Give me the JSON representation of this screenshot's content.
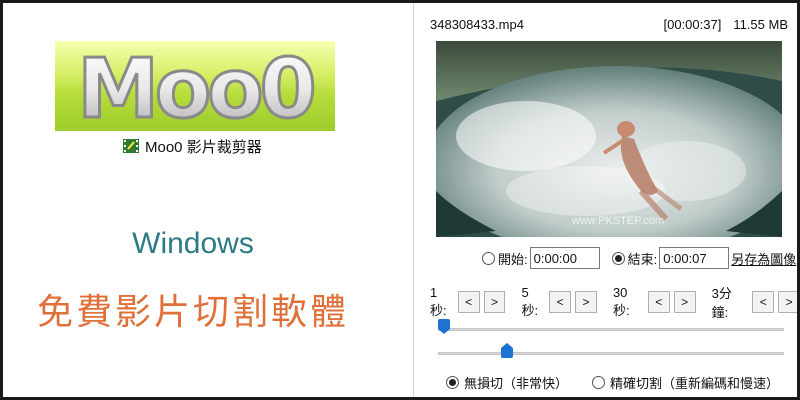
{
  "promo": {
    "logo_text": "Moo0",
    "app_title": "Moo0 影片裁剪器",
    "platform": "Windows",
    "headline": "免費影片切割軟體"
  },
  "app": {
    "file_name": "348308433.mp4",
    "duration": "[00:00:37]",
    "file_size": "11.55 MB",
    "video_watermark": "www.PKSTEP.com",
    "start_label": "開始:",
    "start_value": "0:00:00",
    "end_label": "結束:",
    "end_value": "0:00:07",
    "save_image_link": "另存為圖像",
    "step_controls": [
      {
        "label": "1秒:",
        "back": "<",
        "forward": ">"
      },
      {
        "label": "5秒:",
        "back": "<",
        "forward": ">"
      },
      {
        "label": "30秒:",
        "back": "<",
        "forward": ">"
      },
      {
        "label": "3分鐘:",
        "back": "<",
        "forward": ">"
      }
    ],
    "start_slider_fraction": 0.0,
    "end_slider_fraction": 0.19,
    "cut_modes": [
      {
        "label": "無損切（非常快）",
        "selected": true
      },
      {
        "label": "精確切割（重新編碼和慢速）",
        "selected": false
      }
    ],
    "selected_time_radio": "end"
  },
  "colors": {
    "logo_green": "#b6dd3a",
    "platform_text": "#2b7a86",
    "headline_text": "#e0703a",
    "slider_thumb": "#1e73d2"
  }
}
